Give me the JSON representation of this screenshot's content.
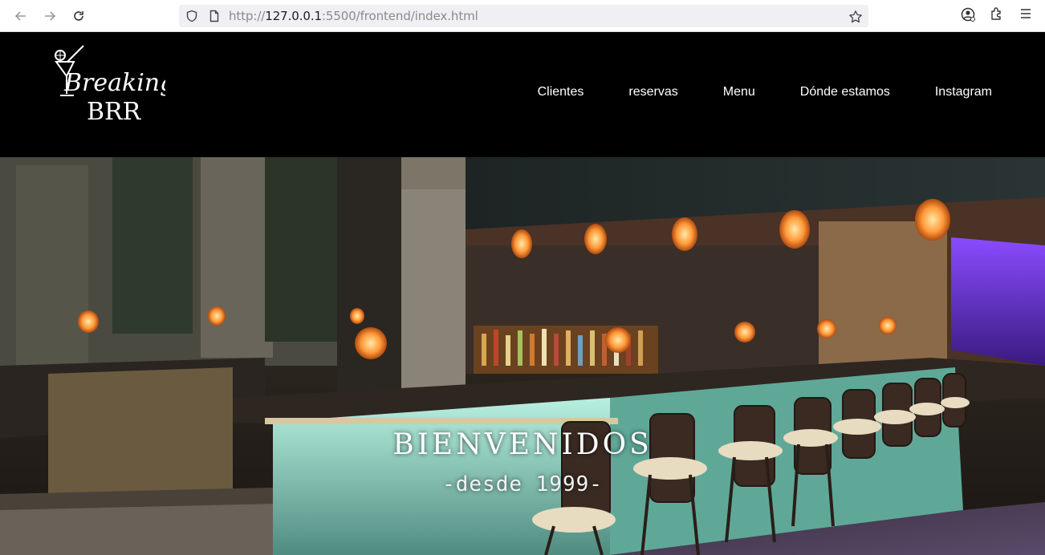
{
  "browser": {
    "url_prefix": "http://",
    "url_host": "127.0.0.1",
    "url_rest": ":5500/frontend/index.html",
    "icons": [
      "back-icon",
      "forward-icon",
      "reload-icon",
      "shield-icon",
      "page-icon",
      "bookmark-star-icon",
      "account-icon",
      "extensions-icon",
      "menu-icon"
    ]
  },
  "header": {
    "logo_line1": "Breaking",
    "logo_line2": "BRR",
    "nav": [
      {
        "label": "Clientes"
      },
      {
        "label": "reservas"
      },
      {
        "label": "Menu"
      },
      {
        "label": "Dónde estamos"
      },
      {
        "label": "Instagram"
      }
    ]
  },
  "hero": {
    "title": "BIENVENIDOS",
    "subtitle": "-desde 1999-"
  },
  "colors": {
    "header_bg": "#000000",
    "nav_text": "#ffffff",
    "bar_counter": "#8fd4c4",
    "lantern": "#ffb347"
  }
}
